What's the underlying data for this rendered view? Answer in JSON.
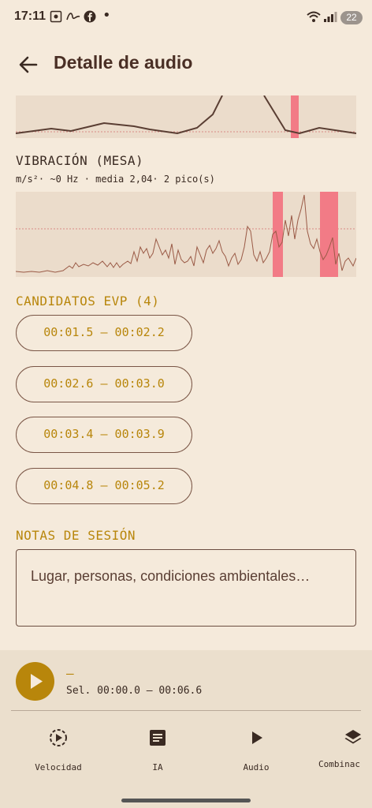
{
  "status_bar": {
    "time": "17:11",
    "battery": "22",
    "left_icons": [
      "screenshot-icon",
      "wave-icon",
      "facebook-icon",
      "dot-icon"
    ],
    "right_icons": [
      "wifi-icon",
      "signal-icon"
    ]
  },
  "appbar": {
    "title": "Detalle de audio",
    "back_icon": "arrow-left-icon"
  },
  "vibration": {
    "title": "VIBRACIÓN (MESA)",
    "subtitle": "m/s²· ~0 Hz · media 2,04· 2 pico(s)"
  },
  "candidates": {
    "title": "CANDIDATOS EVP (4)",
    "items": [
      {
        "label": "00:01.5 – 00:02.2"
      },
      {
        "label": "00:02.6 – 00:03.0"
      },
      {
        "label": "00:03.4 – 00:03.9"
      },
      {
        "label": "00:04.8 – 00:05.2"
      }
    ]
  },
  "notes": {
    "title": "NOTAS DE SESIÓN",
    "placeholder": "Lugar, personas, condiciones ambientales…"
  },
  "player": {
    "track": "—",
    "selection": "Sel. 00:00.0 – 00:06.6",
    "play_icon": "play-icon"
  },
  "bottom_nav": [
    {
      "label": "Velocidad",
      "icon": "speed-icon"
    },
    {
      "label": "IA",
      "icon": "document-icon"
    },
    {
      "label": "Audio",
      "icon": "play-icon"
    },
    {
      "label": "Combinac",
      "icon": "layers-icon"
    }
  ],
  "colors": {
    "background": "#f5eadb",
    "accent": "#b8860b",
    "highlight": "#f27b86",
    "text": "#4a2f25"
  }
}
